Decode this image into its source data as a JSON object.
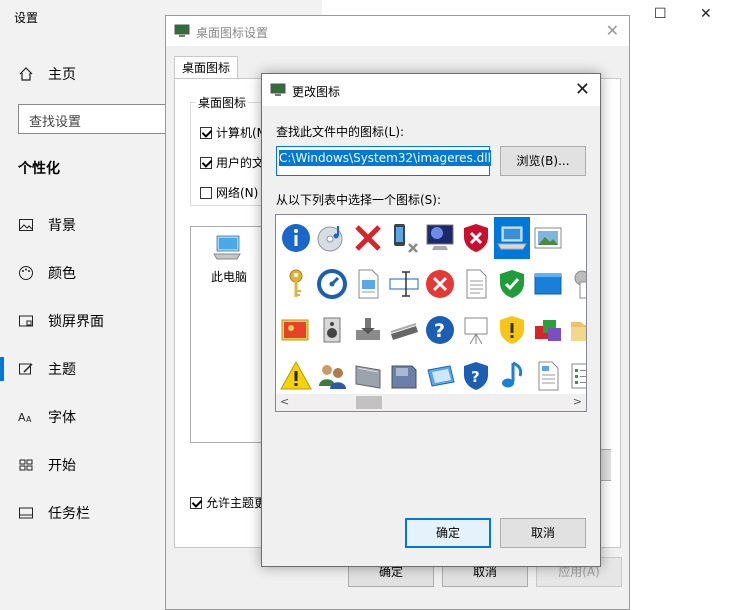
{
  "settings": {
    "title": "设置",
    "home": "主页",
    "search_placeholder": "查找设置",
    "section": "个性化",
    "nav": [
      "背景",
      "颜色",
      "锁屏界面",
      "主题",
      "字体",
      "开始",
      "任务栏"
    ],
    "win_controls": {
      "maximize": "☐",
      "close": "✕"
    }
  },
  "desktop_dialog": {
    "title": "桌面图标设置",
    "close": "✕",
    "tab": "桌面图标",
    "group_label": "桌面图标",
    "checkboxes": [
      {
        "label": "计算机(M",
        "checked": true
      },
      {
        "label": "用户的文",
        "checked": true
      },
      {
        "label": "网络(N)",
        "checked": false
      }
    ],
    "preview_label": "此电脑",
    "allow_theme": "允许主题更",
    "ok": "确定",
    "cancel": "取消",
    "apply": "应用(A)"
  },
  "change_icon_dialog": {
    "title": "更改图标",
    "close": "✕",
    "find_label": "查找此文件中的图标(L):",
    "path_value": "C:\\Windows\\System32\\imageres.dll",
    "browse": "浏览(B)...",
    "list_label": "从以下列表中选择一个图标(S):",
    "ok": "确定",
    "cancel": "取消",
    "icons": [
      [
        "info-icon",
        "cd-music-icon",
        "red-x-icon",
        "phone-x-icon",
        "monitor-icon",
        "shield-x-icon",
        "laptop-icon",
        "picture-icon"
      ],
      [
        "key-icon",
        "speedometer-icon",
        "doc-image-icon",
        "rename-icon",
        "error-icon",
        "text-doc-icon",
        "shield-check-icon",
        "blue-window-icon",
        "settings-doc-icon"
      ],
      [
        "photo-viewer-icon",
        "speaker-icon",
        "disk-drive-icon",
        "scanner-icon",
        "help-icon",
        "projector-icon",
        "shield-warning-icon",
        "programs-icon",
        "folder-icon"
      ],
      [
        "warning-icon",
        "users-icon",
        "drive-icon",
        "disk-icon",
        "network-drive-icon",
        "shield-help-icon",
        "music-note-icon",
        "doc-icon",
        "list-icon"
      ]
    ],
    "selected_icon": "laptop-icon"
  }
}
